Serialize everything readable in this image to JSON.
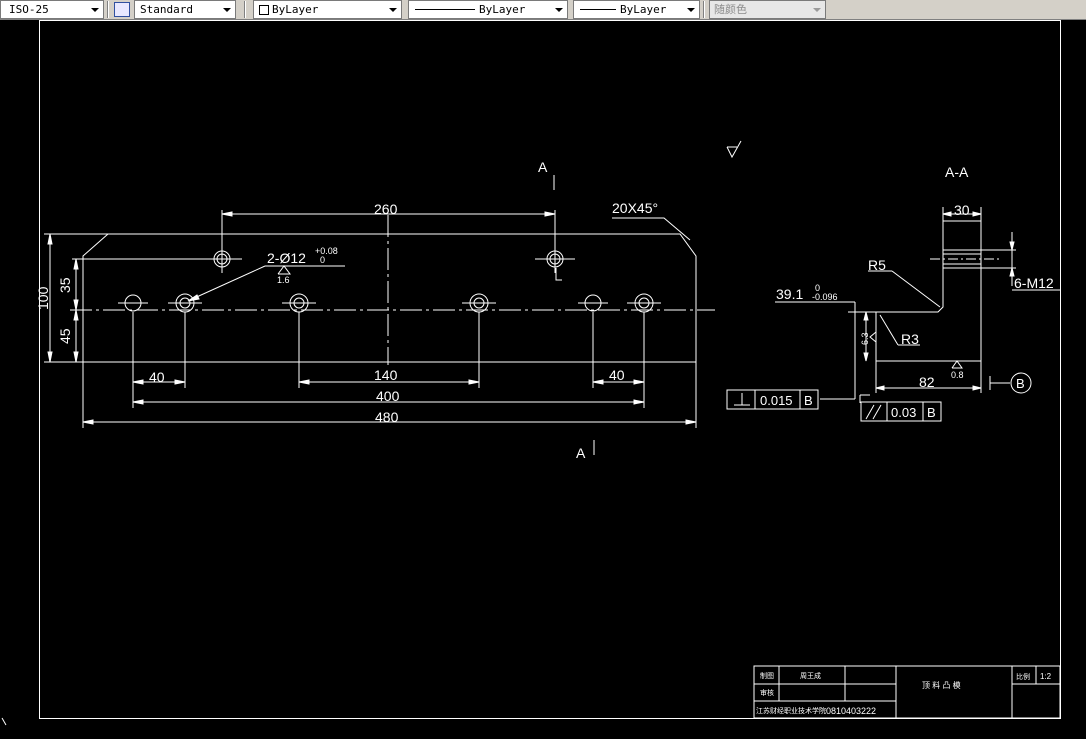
{
  "toolbar": {
    "dimstyle": "ISO-25",
    "textstyle": "Standard",
    "layer": "ByLayer",
    "linetype": "ByLayer",
    "lineweight": "ByLayer",
    "plotstyle": "随颜色"
  },
  "drawing": {
    "section_mark_top": "A",
    "section_mark_bottom": "A",
    "chamfer_note": "20X45°",
    "dim_260": "260",
    "hole_callout": "2-Ø12",
    "hole_tol_upper": "+0.08",
    "hole_tol_lower": "0",
    "roughness_hole": "1.6",
    "dim_100": "100",
    "dim_35": "35",
    "dim_45": "45",
    "dim_40_left": "40",
    "dim_140": "140",
    "dim_40_right": "40",
    "dim_400": "400",
    "dim_480": "480",
    "section_title": "A-A",
    "dim_30": "30",
    "radius_r5": "R5",
    "thread_note": "6-M12",
    "dim_39_1": "39.1",
    "dim_39_tol_upper": "0",
    "dim_39_tol_lower": "-0.096",
    "roughness_side": "6.3",
    "radius_r3": "R3",
    "dim_82": "82",
    "roughness_base": "0.8",
    "datum_b": "B",
    "gdt_perp_value": "0.015",
    "gdt_perp_datum": "B",
    "gdt_par_value": "0.03",
    "gdt_par_datum": "B"
  },
  "title_block": {
    "label_drawn": "制图",
    "name_drawn": "周王成",
    "label_check": "审核",
    "school": "江苏财经职业技术学院",
    "student_id": "0810403222",
    "part_name": "顶 料 凸 模",
    "label_scale": "比例",
    "scale_value": "1:2"
  }
}
